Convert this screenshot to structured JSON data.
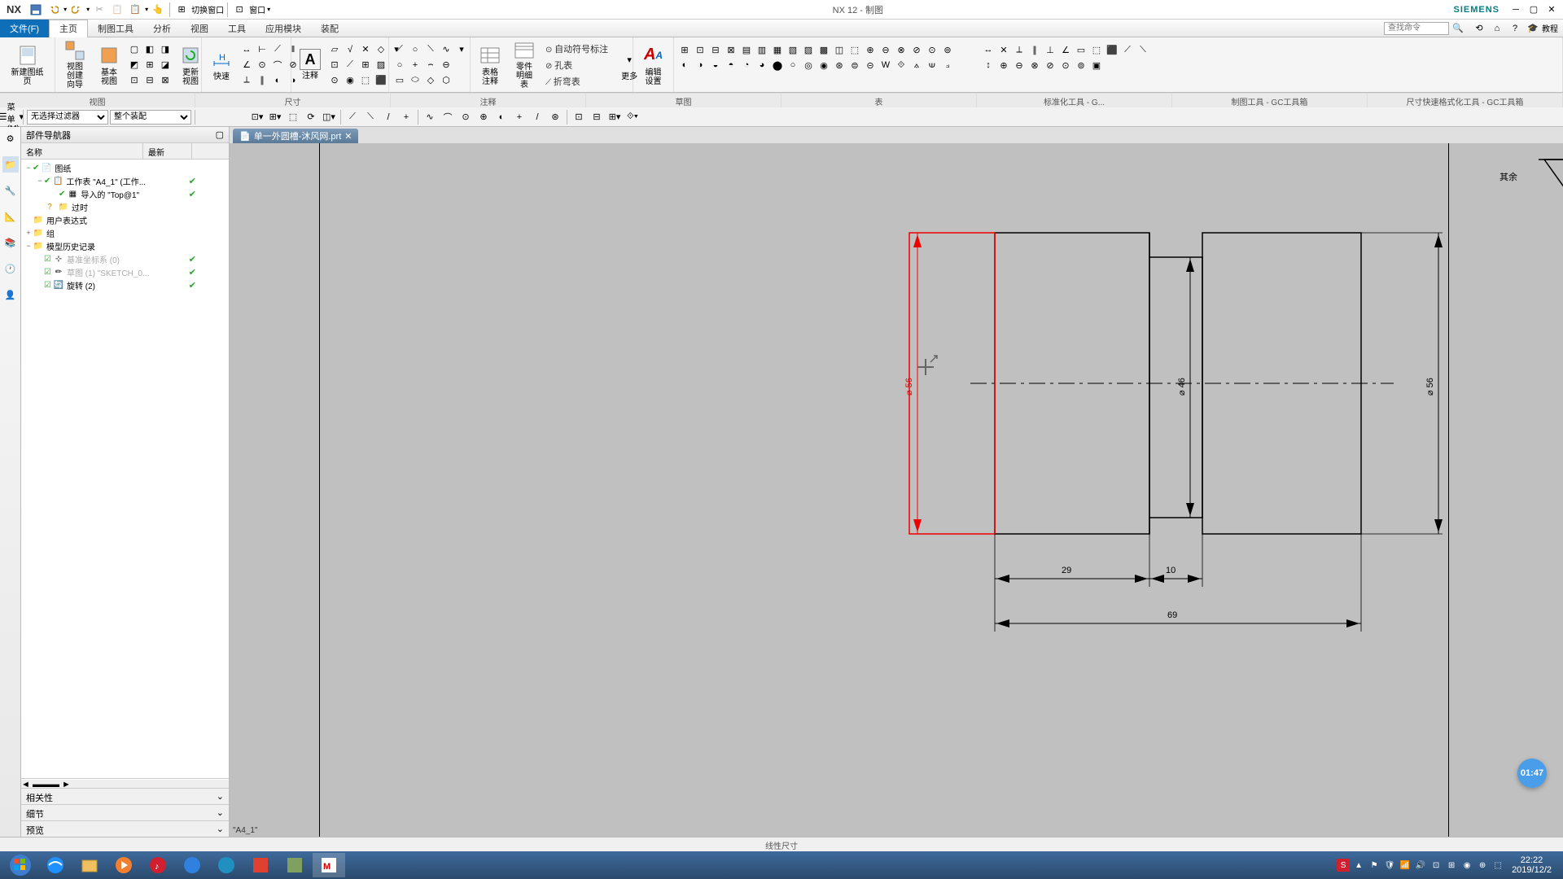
{
  "titlebar": {
    "app": "NX",
    "switch_window": "切换窗口",
    "window_menu": "窗口",
    "title": "NX 12 - 制图",
    "brand": "SIEMENS"
  },
  "menubar": {
    "file": "文件(F)",
    "tabs": [
      "主页",
      "制图工具",
      "分析",
      "视图",
      "工具",
      "应用模块",
      "装配"
    ],
    "search_placeholder": "查找命令",
    "tutorial": "教程"
  },
  "ribbon": {
    "new_sheet": "新建图纸页",
    "view_wizard": "视图创建向导",
    "base_view": "基本视图",
    "update_view": "更新视图",
    "rapid": "快速",
    "note": "注释",
    "table_note": "表格注释",
    "parts_list": "零件明细表",
    "auto_balloon": "自动符号标注",
    "hole_table": "孔表",
    "bend_table": "折弯表",
    "more": "更多",
    "edit_settings": "编辑设置"
  },
  "group_labels": {
    "view": "视图",
    "dimension": "尺寸",
    "annotation": "注释",
    "sketch": "草图",
    "table": "表",
    "std_tools": "标准化工具 - G...",
    "draft_tools": "制图工具 - GC工具箱",
    "dim_tools": "尺寸快速格式化工具 - GC工具箱"
  },
  "toolbar": {
    "menu_btn": "菜单(M)",
    "filter1": "无选择过滤器",
    "filter2": "整个装配"
  },
  "navigator": {
    "title": "部件导航器",
    "col_name": "名称",
    "col_latest": "最新",
    "tree": {
      "drawings": "图纸",
      "sheet_a4": "工作表 \"A4_1\" (工作...",
      "imported_top": "导入的 \"Top@1\"",
      "outdated": "过时",
      "user_expr": "用户表达式",
      "group": "组",
      "model_history": "模型历史记录",
      "datum_csys": "基准坐标系 (0)",
      "sketch": "草图 (1) \"SKETCH_0...",
      "revolve": "旋转 (2)"
    },
    "sections": {
      "related": "相关性",
      "details": "细节",
      "preview": "预览"
    }
  },
  "doc_tab": {
    "name": "单一外圆槽-沐风网.prt"
  },
  "chart_data": {
    "type": "engineering-drawing",
    "dimensions": {
      "dia_56_left": "⌀ 56",
      "dia_46": "⌀ 46",
      "dia_56_right": "⌀ 56",
      "len_29": "29",
      "len_10": "10",
      "len_69": "69"
    },
    "annotation_tr": "其余",
    "sheet_label": "\"A4_1\"",
    "selected_dim": "dia_56_left"
  },
  "status": "线性尺寸",
  "video_time": "01:47",
  "clock": {
    "time": "22:22",
    "date": "2019/12/2"
  }
}
